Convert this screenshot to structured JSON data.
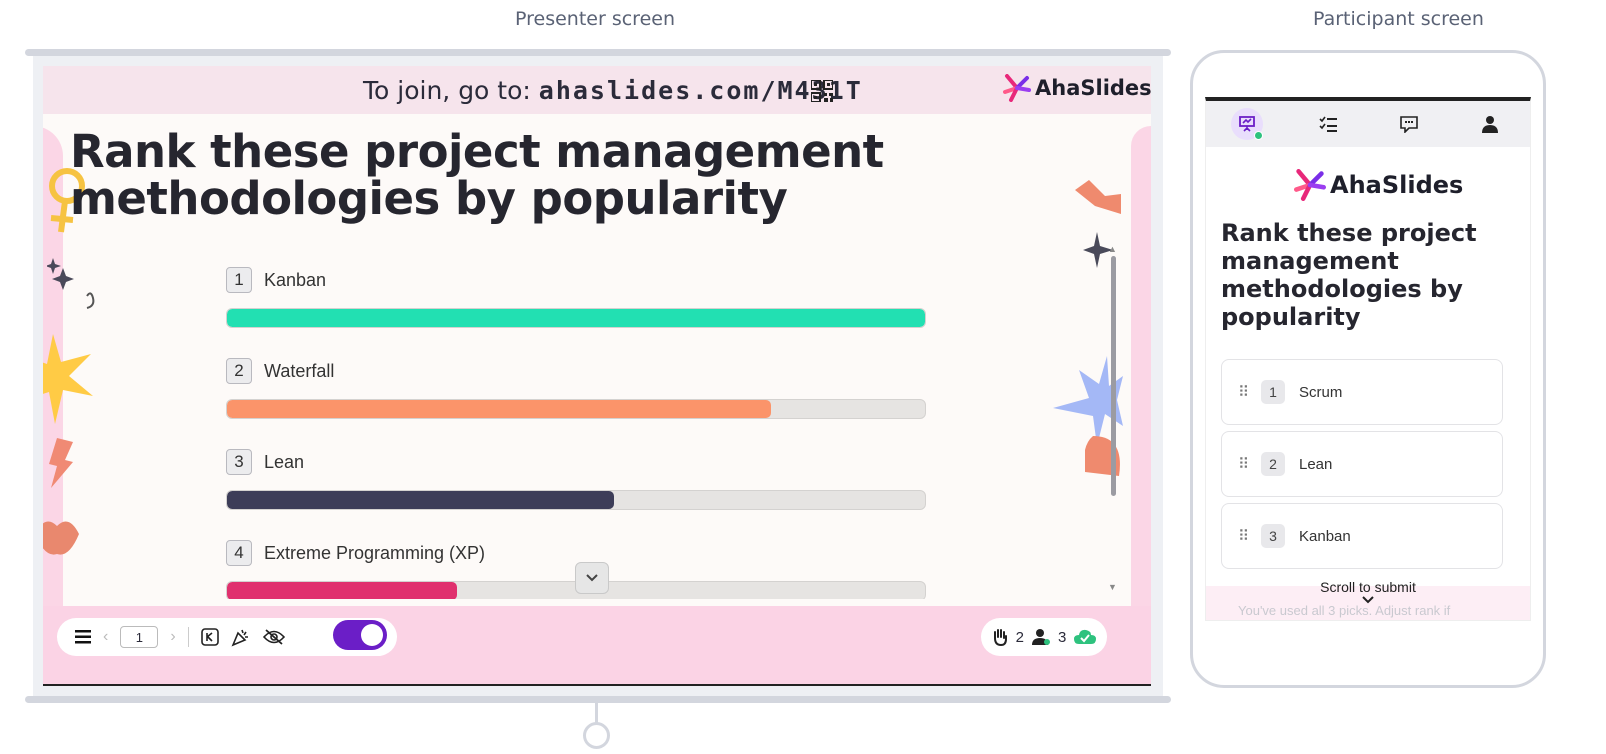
{
  "captions": {
    "presenter": "Presenter screen",
    "participant": "Participant screen"
  },
  "slide": {
    "join_prefix": "To join, go to: ",
    "join_code": "ahaslides.com/M431T",
    "brand": "AhaSlides",
    "title": "Rank these project management methodologies by popularity",
    "results": [
      {
        "rank": "1",
        "label": "Kanban",
        "fraction": 1.0,
        "color": "#22e0b2"
      },
      {
        "rank": "2",
        "label": "Waterfall",
        "fraction": 0.78,
        "color": "#fb946a"
      },
      {
        "rank": "3",
        "label": "Lean",
        "fraction": 0.555,
        "color": "#3d3d58"
      },
      {
        "rank": "4",
        "label": "Extreme Programming (XP)",
        "fraction": 0.33,
        "color": "#e0306e"
      }
    ]
  },
  "toolbar": {
    "page_number": "1",
    "hands_raised": "2",
    "participants": "3",
    "accent": "#6b1ec7"
  },
  "participant": {
    "brand": "AhaSlides",
    "title": "Rank these project management methodologies by popularity",
    "items": [
      {
        "rank": "1",
        "label": "Scrum"
      },
      {
        "rank": "2",
        "label": "Lean"
      },
      {
        "rank": "3",
        "label": "Kanban"
      }
    ],
    "scroll_label": "Scroll to submit",
    "used_note": "You've used all 3 picks. Adjust rank if"
  }
}
